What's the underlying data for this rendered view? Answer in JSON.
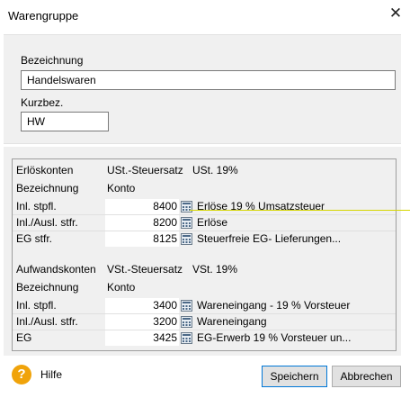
{
  "window": {
    "title": "Warengruppe",
    "close_icon": "close-icon"
  },
  "fields": {
    "bezeichnung_label": "Bezeichnung",
    "bezeichnung_value": "Handelswaren",
    "kurzbez_label": "Kurzbez.",
    "kurzbez_value": "HW"
  },
  "erloese": {
    "header": [
      "Erlöskonten",
      "USt.-Steuersatz",
      "USt. 19%"
    ],
    "subheader": [
      "Bezeichnung",
      "Konto"
    ],
    "rows": [
      {
        "label": "Inl. stpfl.",
        "konto": "8400",
        "desc": "Erlöse 19 % Umsatzsteuer"
      },
      {
        "label": "Inl./Ausl. stfr.",
        "konto": "8200",
        "desc": "Erlöse"
      },
      {
        "label": "EG stfr.",
        "konto": "8125",
        "desc": "Steuerfreie EG- Lieferungen..."
      }
    ]
  },
  "aufwand": {
    "header": [
      "Aufwandskonten",
      "VSt.-Steuersatz",
      "VSt. 19%"
    ],
    "subheader": [
      "Bezeichnung",
      "Konto"
    ],
    "rows": [
      {
        "label": "Inl. stpfl.",
        "konto": "3400",
        "desc": "Wareneingang - 19 % Vorsteuer"
      },
      {
        "label": "Inl./Ausl. stfr.",
        "konto": "3200",
        "desc": "Wareneingang"
      },
      {
        "label": "EG",
        "konto": "3425",
        "desc": "EG-Erwerb 19 % Vorsteuer un..."
      }
    ]
  },
  "footer": {
    "help_label": "Hilfe",
    "help_glyph": "?",
    "save_label": "Speichern",
    "cancel_label": "Abbrechen"
  },
  "colors": {
    "accent": "#0078d7",
    "help": "#f0a30a",
    "pointer": "#d6d600"
  }
}
